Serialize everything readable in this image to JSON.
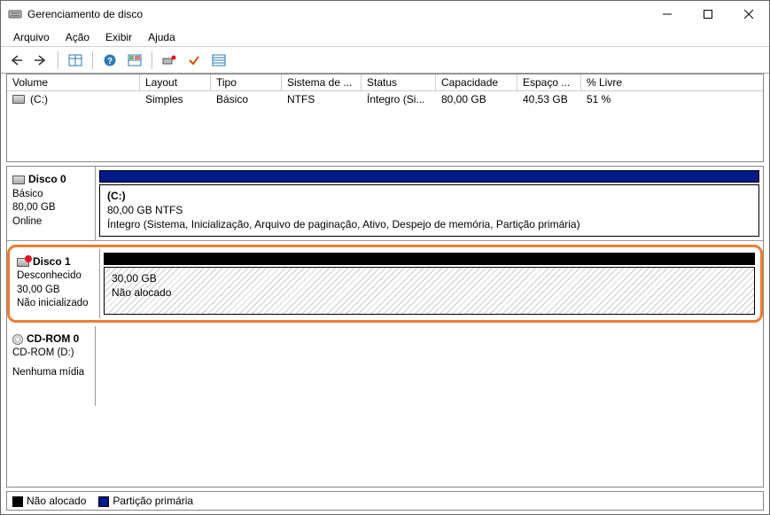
{
  "window": {
    "title": "Gerenciamento de disco"
  },
  "menu": {
    "arquivo": "Arquivo",
    "acao": "Ação",
    "exibir": "Exibir",
    "ajuda": "Ajuda"
  },
  "columns": {
    "volume": "Volume",
    "layout": "Layout",
    "tipo": "Tipo",
    "sistema": "Sistema de ...",
    "status": "Status",
    "capacidade": "Capacidade",
    "espaco": "Espaço ...",
    "livre": "% Livre"
  },
  "volumes": [
    {
      "name": "(C:)",
      "layout": "Simples",
      "tipo": "Básico",
      "fs": "NTFS",
      "status": "Íntegro (Si...",
      "cap": "80,00 GB",
      "free": "40,53 GB",
      "pct": "51 %"
    }
  ],
  "disks": {
    "d0": {
      "title": "Disco 0",
      "type": "Básico",
      "size": "80,00 GB",
      "state": "Online",
      "part": {
        "label": "(C:)",
        "line2": "80,00 GB NTFS",
        "line3": "Íntegro (Sistema, Inicialização, Arquivo de paginação, Ativo, Despejo de memória, Partição primária)"
      },
      "barcolor": "#001a87"
    },
    "d1": {
      "title": "Disco 1",
      "type": "Desconhecido",
      "size": "30,00 GB",
      "state": "Não inicializado",
      "part": {
        "line1": "30,00 GB",
        "line2": "Não alocado"
      },
      "barcolor": "#000000"
    },
    "cd": {
      "title": "CD-ROM 0",
      "type": "CD-ROM (D:)",
      "state": "Nenhuma mídia"
    }
  },
  "legend": {
    "unalloc": "Não alocado",
    "primary": "Partição primária"
  }
}
